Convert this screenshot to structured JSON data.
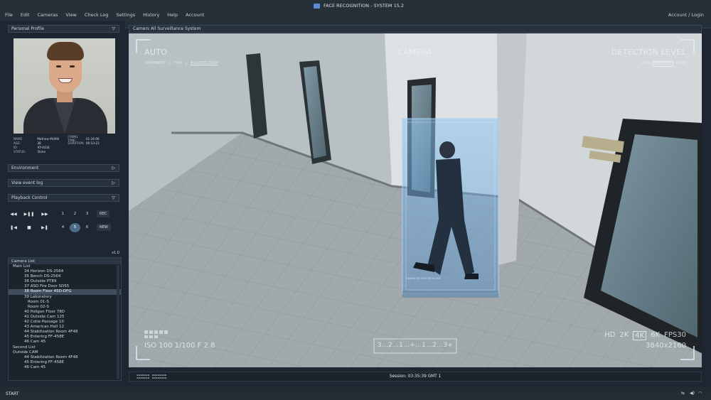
{
  "menubar": {
    "items": [
      "File",
      "Edit",
      "Cameras",
      "View",
      "Check Log",
      "Settings",
      "History",
      "Help",
      "Account"
    ],
    "title": "FACE RECOGNITION - SYSTEM 15.2",
    "account_login": "Account / Login"
  },
  "left": {
    "personal_profile": "Personal Profile",
    "profile": {
      "name_label": "NAME",
      "name_value": "Mathew McMill",
      "age_label": "AGE:",
      "age_value": "38",
      "id_label": "ID:",
      "id_value": "KY-4434",
      "status_label": "STATUS:",
      "status_value": "Done",
      "fixing_label": "FIXING TIME:",
      "fixing_value": "01:34:06",
      "duration_label": "DURATION:",
      "duration_value": "00:13:23"
    },
    "environment": "Environment",
    "view_event_log": "View event log",
    "playback_control": "Playback Control",
    "playback": {
      "row1_nums": [
        "1",
        "2",
        "3"
      ],
      "rec": "REC",
      "row2_nums": [
        "4",
        "5",
        "6"
      ],
      "new": "NEW",
      "speed": "x1.0"
    },
    "camera_list": {
      "header": "Camera List",
      "items": [
        {
          "label": "Main List",
          "kind": "group"
        },
        {
          "label": "34 Horizon DS-2564",
          "kind": "item"
        },
        {
          "label": "35 Bench DS-2564",
          "kind": "item"
        },
        {
          "label": "36 Outside PT89",
          "kind": "item"
        },
        {
          "label": "37 ASD Fire Door SD55",
          "kind": "item"
        },
        {
          "label": "38 Room Floor 45D-DFG",
          "kind": "sel"
        },
        {
          "label": "39 Laboratory",
          "kind": "item"
        },
        {
          "label": "Room 01-S",
          "kind": "sub"
        },
        {
          "label": "Room 02-S",
          "kind": "sub"
        },
        {
          "label": "40 Poligon Floor 78D",
          "kind": "item"
        },
        {
          "label": "41 Outside Cam 125",
          "kind": "item"
        },
        {
          "label": "42 Cotie Passage 10",
          "kind": "item"
        },
        {
          "label": "43 American Hall 12",
          "kind": "item"
        },
        {
          "label": "44 Stabilization Room 4F48",
          "kind": "item"
        },
        {
          "label": "45 Entering FF-458E",
          "kind": "item"
        },
        {
          "label": "46 Cam 45",
          "kind": "item"
        },
        {
          "label": "Second List",
          "kind": "group"
        },
        {
          "label": "Outside CAM",
          "kind": "group"
        },
        {
          "label": "44 Stabilization Room 4F48",
          "kind": "item"
        },
        {
          "label": "45 Entering FF-458E",
          "kind": "item"
        },
        {
          "label": "46 Cam 45",
          "kind": "item"
        }
      ]
    }
  },
  "main": {
    "header": "Camers All Surveillance System",
    "hud": {
      "mode": "AUTO",
      "camera": "CAMERA",
      "detection_level": "DETECTION LEVEL",
      "submenu": [
        "CONTRAST",
        "FOV",
        "AI DETECTION"
      ],
      "levels": [
        "LOW",
        "MEDIUM",
        "HIGH"
      ],
      "exposure": "ISO 100 1/100 F 2.8",
      "resolutions": [
        "HD",
        "2K",
        "4K",
        "6K",
        "FPS30"
      ],
      "res_detail": "3840x2160",
      "counter": "3...2...1...+...1...2...3+",
      "detection_label": "HUMAN MOTION DETECTED"
    },
    "session": "Session: 03:35:39 GMT 1"
  },
  "bottom": {
    "start": "START"
  },
  "colors": {
    "accent": "#4c6c88",
    "panel": "#1e2731",
    "detection": "#6ea8e6"
  }
}
